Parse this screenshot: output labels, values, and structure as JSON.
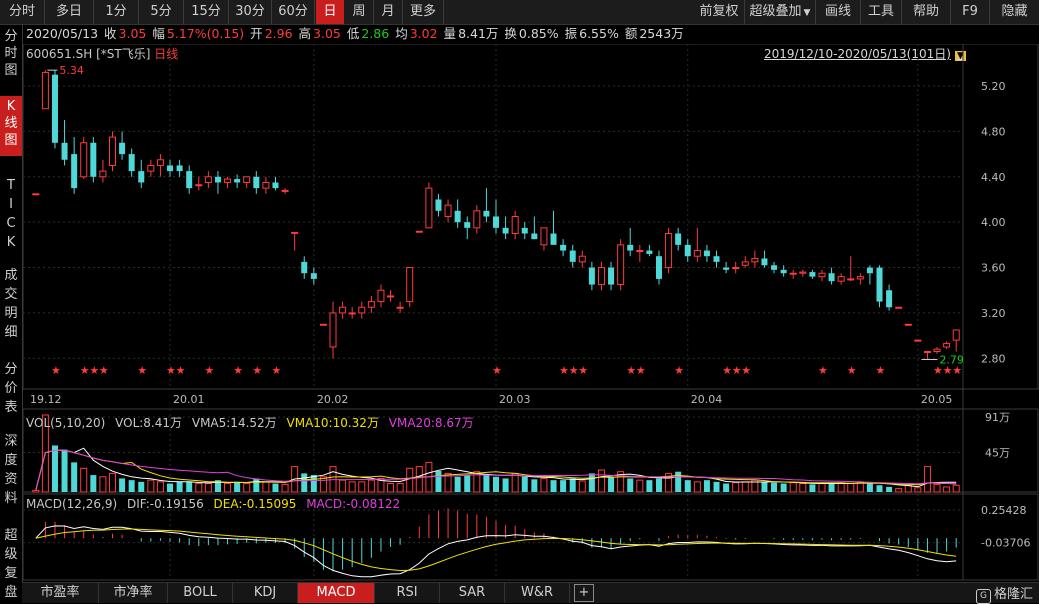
{
  "toolbar": {
    "periods": [
      "分时",
      "多日",
      "1分",
      "5分",
      "15分",
      "30分",
      "60分",
      "日",
      "周",
      "月",
      "更多"
    ],
    "active_period": "日",
    "right_items": [
      "前复权",
      "超级叠加",
      "画线",
      "工具",
      "帮助",
      "F9",
      "隐藏"
    ]
  },
  "info": {
    "date": "2020/05/13",
    "close_label": "收",
    "close": "3.05",
    "change_label": "幅",
    "change": "5.17%(0.15)",
    "open_label": "开",
    "open": "2.96",
    "high_label": "高",
    "high": "3.05",
    "low_label": "低",
    "low": "2.86",
    "avg_label": "均",
    "avg": "3.02",
    "vol_label": "量",
    "vol": "8.41万",
    "turnover_label": "换",
    "turnover": "0.85%",
    "amp_label": "振",
    "amp": "6.55%",
    "amount_label": "额",
    "amount": "2543万"
  },
  "symbol": {
    "code": "600651.SH",
    "name": "[*ST飞乐]",
    "period": "日线"
  },
  "range_text": "2019/12/10-2020/05/13(101日)",
  "left_tabs": [
    {
      "label": "分时图",
      "active": false
    },
    {
      "label": "K线图",
      "active": true
    },
    {
      "label": "TICK",
      "active": false
    },
    {
      "label": "成交明细",
      "active": false
    },
    {
      "label": "分价表",
      "active": false
    },
    {
      "label": "深度资料",
      "active": false
    },
    {
      "label": "超级复盘",
      "active": false
    }
  ],
  "price_axis": [
    "5.20",
    "4.80",
    "4.40",
    "4.00",
    "3.60",
    "3.20",
    "2.80"
  ],
  "annotations": {
    "high": "5.34",
    "low": "2.79"
  },
  "date_axis": [
    "19.12",
    "20.01",
    "20.02",
    "20.03",
    "20.04",
    "20.05"
  ],
  "vol_title": "VOL(5,10,20)",
  "vol_values": {
    "vol": "VOL:8.41万",
    "vma5": "VMA5:14.52万",
    "vma10": "VMA10:10.32万",
    "vma20": "VMA20:8.67万"
  },
  "vol_axis": [
    "91万",
    "45万"
  ],
  "macd_title": "MACD(12,26,9)",
  "macd_values": {
    "dif": "DIF:-0.19156",
    "dea": "DEA:-0.15095",
    "macd": "MACD:-0.08122"
  },
  "macd_axis": [
    "0.25428",
    "-0.03706"
  ],
  "bottom_tabs": [
    {
      "label": "市盈率",
      "active": false
    },
    {
      "label": "市净率",
      "active": false
    },
    {
      "label": "BOLL",
      "active": false
    },
    {
      "label": "KDJ",
      "active": false
    },
    {
      "label": "MACD",
      "active": true
    },
    {
      "label": "RSI",
      "active": false
    },
    {
      "label": "SAR",
      "active": false
    },
    {
      "label": "W&R",
      "active": false
    },
    {
      "label": "+",
      "active": false
    }
  ],
  "brand": "格隆汇",
  "colors": {
    "up": "#ff3b3b",
    "down": "#4fd8d8",
    "accent": "#c81e1e"
  },
  "chart_data": {
    "type": "candlestick",
    "title": "600651.SH [*ST飞乐] 日线",
    "x_labels": [
      "19.12",
      "20.01",
      "20.02",
      "20.03",
      "20.04",
      "20.05"
    ],
    "y_range": [
      2.6,
      5.5
    ],
    "candles": [
      [
        4.25,
        4.25,
        4.25,
        4.25
      ],
      [
        5.0,
        5.34,
        5.0,
        5.32
      ],
      [
        5.3,
        5.34,
        4.65,
        4.7
      ],
      [
        4.7,
        4.9,
        4.5,
        4.55
      ],
      [
        4.6,
        4.75,
        4.25,
        4.3
      ],
      [
        4.4,
        4.75,
        4.38,
        4.7
      ],
      [
        4.7,
        4.75,
        4.35,
        4.4
      ],
      [
        4.4,
        4.55,
        4.35,
        4.45
      ],
      [
        4.5,
        4.8,
        4.45,
        4.75
      ],
      [
        4.7,
        4.8,
        4.55,
        4.6
      ],
      [
        4.6,
        4.65,
        4.4,
        4.45
      ],
      [
        4.45,
        4.55,
        4.3,
        4.35
      ],
      [
        4.45,
        4.55,
        4.4,
        4.5
      ],
      [
        4.5,
        4.6,
        4.4,
        4.55
      ],
      [
        4.5,
        4.55,
        4.4,
        4.45
      ],
      [
        4.5,
        4.55,
        4.4,
        4.45
      ],
      [
        4.45,
        4.5,
        4.25,
        4.3
      ],
      [
        4.33,
        4.4,
        4.28,
        4.33
      ],
      [
        4.35,
        4.45,
        4.3,
        4.4
      ],
      [
        4.4,
        4.45,
        4.25,
        4.35
      ],
      [
        4.35,
        4.4,
        4.3,
        4.38
      ],
      [
        4.38,
        4.42,
        4.3,
        4.35
      ],
      [
        4.35,
        4.4,
        4.3,
        4.4
      ],
      [
        4.4,
        4.45,
        4.25,
        4.3
      ],
      [
        4.3,
        4.4,
        4.25,
        4.35
      ],
      [
        4.35,
        4.4,
        4.28,
        4.3
      ],
      [
        4.28,
        4.3,
        4.25,
        4.28
      ],
      [
        3.91,
        3.91,
        3.75,
        3.91
      ],
      [
        3.65,
        3.7,
        3.5,
        3.55
      ],
      [
        3.55,
        3.6,
        3.45,
        3.5
      ],
      [
        3.1,
        3.1,
        3.1,
        3.1
      ],
      [
        2.9,
        3.3,
        2.8,
        3.2
      ],
      [
        3.2,
        3.3,
        3.15,
        3.25
      ],
      [
        3.2,
        3.25,
        3.15,
        3.2
      ],
      [
        3.2,
        3.3,
        3.15,
        3.25
      ],
      [
        3.25,
        3.35,
        3.2,
        3.3
      ],
      [
        3.3,
        3.45,
        3.25,
        3.4
      ],
      [
        3.35,
        3.4,
        3.3,
        3.35
      ],
      [
        3.25,
        3.3,
        3.2,
        3.25
      ],
      [
        3.3,
        3.6,
        3.25,
        3.6
      ],
      [
        3.92,
        3.92,
        3.92,
        3.92
      ],
      [
        3.95,
        4.35,
        3.95,
        4.3
      ],
      [
        4.2,
        4.25,
        4.05,
        4.1
      ],
      [
        4.05,
        4.2,
        4.0,
        4.15
      ],
      [
        4.1,
        4.2,
        3.95,
        4.0
      ],
      [
        4.0,
        4.05,
        3.85,
        3.95
      ],
      [
        3.95,
        4.15,
        3.9,
        4.1
      ],
      [
        4.1,
        4.3,
        4.0,
        4.05
      ],
      [
        4.05,
        4.2,
        3.9,
        3.95
      ],
      [
        3.95,
        4.05,
        3.85,
        3.9
      ],
      [
        3.9,
        4.1,
        3.85,
        4.05
      ],
      [
        3.95,
        4.0,
        3.85,
        3.9
      ],
      [
        3.9,
        4.05,
        3.85,
        3.85
      ],
      [
        3.8,
        3.95,
        3.75,
        3.95
      ],
      [
        3.9,
        4.1,
        3.85,
        3.8
      ],
      [
        3.8,
        3.85,
        3.7,
        3.75
      ],
      [
        3.75,
        3.8,
        3.6,
        3.65
      ],
      [
        3.65,
        3.75,
        3.6,
        3.7
      ],
      [
        3.6,
        3.65,
        3.4,
        3.45
      ],
      [
        3.45,
        3.65,
        3.4,
        3.6
      ],
      [
        3.6,
        3.65,
        3.4,
        3.45
      ],
      [
        3.45,
        3.85,
        3.4,
        3.8
      ],
      [
        3.8,
        3.95,
        3.7,
        3.75
      ],
      [
        3.75,
        3.8,
        3.65,
        3.75
      ],
      [
        3.75,
        3.8,
        3.7,
        3.72
      ],
      [
        3.7,
        3.75,
        3.45,
        3.5
      ],
      [
        3.6,
        3.95,
        3.55,
        3.9
      ],
      [
        3.9,
        3.95,
        3.75,
        3.8
      ],
      [
        3.8,
        3.85,
        3.65,
        3.7
      ],
      [
        3.7,
        3.95,
        3.65,
        3.75
      ],
      [
        3.75,
        3.8,
        3.65,
        3.7
      ],
      [
        3.7,
        3.75,
        3.6,
        3.65
      ],
      [
        3.6,
        3.65,
        3.55,
        3.58
      ],
      [
        3.6,
        3.65,
        3.55,
        3.6
      ],
      [
        3.62,
        3.7,
        3.6,
        3.65
      ],
      [
        3.65,
        3.75,
        3.6,
        3.68
      ],
      [
        3.68,
        3.75,
        3.6,
        3.62
      ],
      [
        3.62,
        3.65,
        3.55,
        3.58
      ],
      [
        3.58,
        3.62,
        3.52,
        3.55
      ],
      [
        3.55,
        3.58,
        3.5,
        3.55
      ],
      [
        3.55,
        3.58,
        3.52,
        3.56
      ],
      [
        3.56,
        3.58,
        3.5,
        3.52
      ],
      [
        3.52,
        3.58,
        3.48,
        3.55
      ],
      [
        3.55,
        3.6,
        3.45,
        3.48
      ],
      [
        3.48,
        3.55,
        3.45,
        3.52
      ],
      [
        3.5,
        3.7,
        3.48,
        3.5
      ],
      [
        3.5,
        3.55,
        3.45,
        3.52
      ],
      [
        3.6,
        3.62,
        3.45,
        3.55
      ],
      [
        3.6,
        3.62,
        3.25,
        3.3
      ],
      [
        3.4,
        3.45,
        3.22,
        3.25
      ],
      [
        3.25,
        3.25,
        3.25,
        3.25
      ],
      [
        3.1,
        3.1,
        3.1,
        3.1
      ],
      [
        2.96,
        2.96,
        2.96,
        2.96
      ],
      [
        2.86,
        2.86,
        2.79,
        2.86
      ],
      [
        2.86,
        2.9,
        2.84,
        2.88
      ],
      [
        2.9,
        2.95,
        2.88,
        2.93
      ],
      [
        2.96,
        3.05,
        2.86,
        3.05
      ]
    ],
    "volumes": [
      2,
      91,
      55,
      50,
      35,
      28,
      20,
      18,
      22,
      16,
      14,
      12,
      14,
      12,
      10,
      12,
      12,
      10,
      10,
      14,
      10,
      12,
      10,
      16,
      12,
      10,
      9,
      30,
      22,
      20,
      18,
      30,
      14,
      12,
      12,
      14,
      16,
      10,
      10,
      28,
      30,
      35,
      25,
      22,
      18,
      20,
      24,
      20,
      18,
      16,
      22,
      18,
      15,
      16,
      14,
      14,
      16,
      13,
      22,
      26,
      18,
      24,
      16,
      14,
      14,
      16,
      22,
      24,
      14,
      12,
      14,
      12,
      10,
      11,
      12,
      14,
      12,
      11,
      10,
      11,
      10,
      9,
      10,
      10,
      11,
      10,
      12,
      12,
      8,
      6,
      4,
      8,
      5,
      30,
      9,
      6,
      8
    ],
    "vol_axis_max": 91,
    "macd_range": [
      -0.28,
      0.3
    ]
  }
}
